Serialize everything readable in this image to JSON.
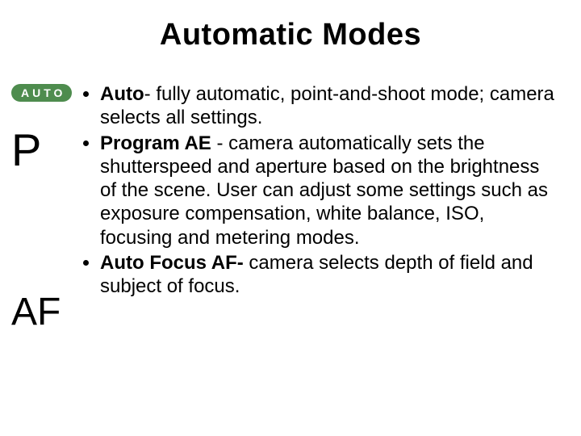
{
  "title": "Automatic Modes",
  "icons": {
    "auto_pill": "AUTO",
    "p": "P",
    "af": "AF"
  },
  "bullets": {
    "auto": {
      "term": "Auto",
      "rest": "- fully automatic, point-and-shoot mode; camera selects all settings."
    },
    "program": {
      "term": "Program AE",
      "rest": " - camera automatically sets the shutterspeed and aperture based on the brightness of the scene. User can adjust some settings such as exposure compensation, white balance, ISO, focusing and metering modes."
    },
    "autofocus": {
      "term": "Auto Focus AF-",
      "rest": " camera selects depth of field and subject of focus."
    }
  }
}
